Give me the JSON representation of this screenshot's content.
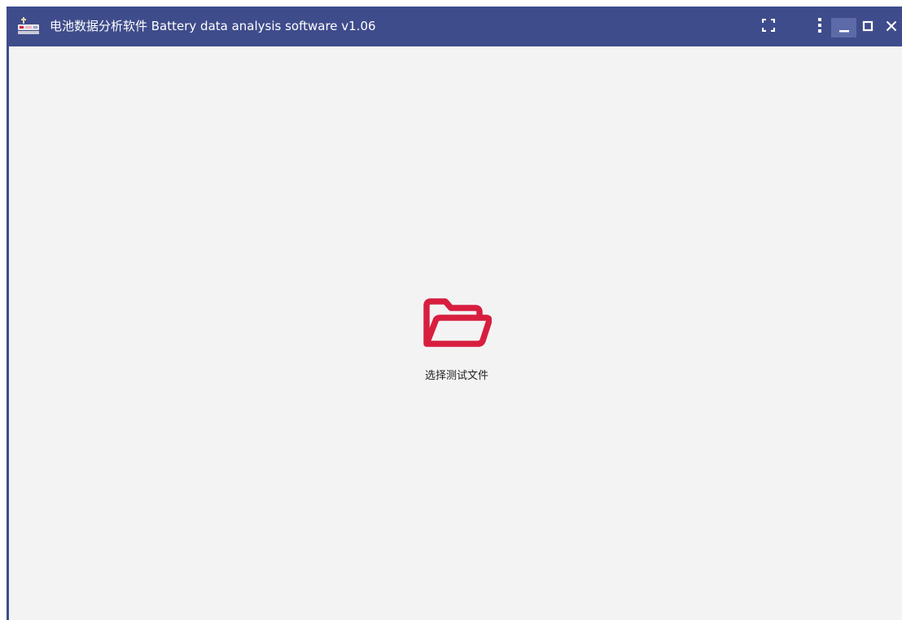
{
  "window": {
    "title": "电池数据分析软件 Battery data analysis software v1.06",
    "app_icon": "battery-app-icon"
  },
  "title_bar_controls": {
    "fullscreen_icon": "fullscreen-icon",
    "menu_icon": "more-vertical-icon",
    "minimize_icon": "minimize-icon",
    "maximize_icon": "maximize-icon",
    "close_icon": "close-icon"
  },
  "main": {
    "folder_icon": "folder-open-icon",
    "open_file_label": "选择测试文件"
  },
  "colors": {
    "title_bar": "#3f4c8b",
    "content_background": "#f3f3f3",
    "accent": "#d81e3f",
    "minimize_highlight": "#5c6aa7"
  }
}
